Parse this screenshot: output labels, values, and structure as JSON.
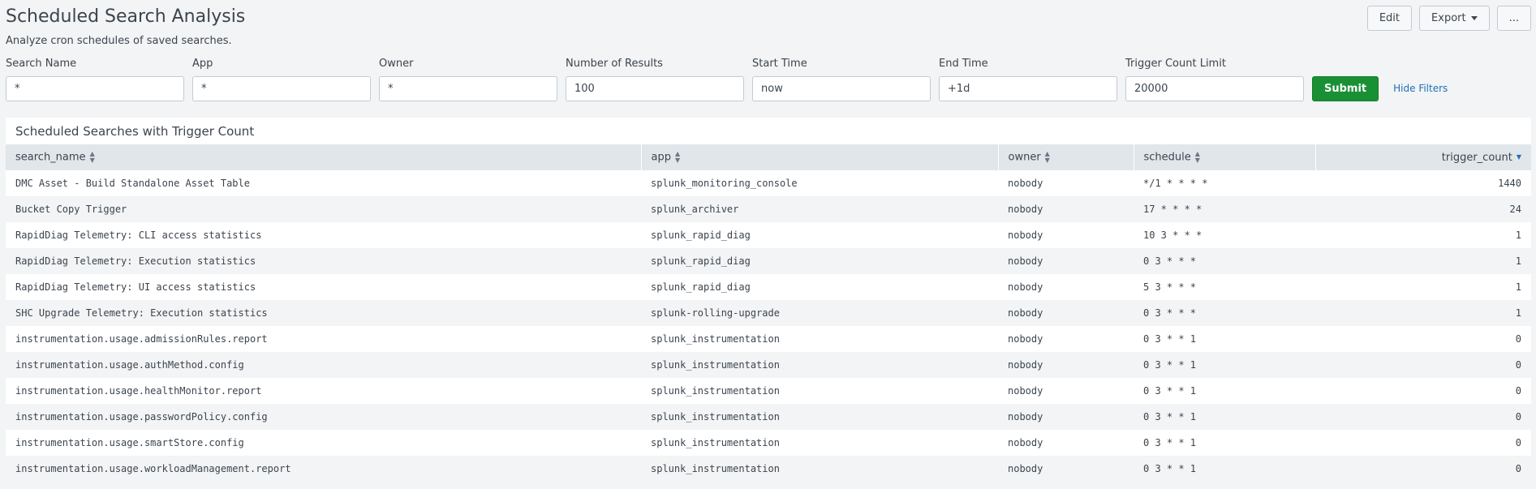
{
  "header": {
    "title": "Scheduled Search Analysis",
    "description": "Analyze cron schedules of saved searches.",
    "actions": {
      "edit": "Edit",
      "export": "Export",
      "more": "..."
    }
  },
  "filters": [
    {
      "label": "Search Name",
      "value": "*"
    },
    {
      "label": "App",
      "value": "*"
    },
    {
      "label": "Owner",
      "value": "*"
    },
    {
      "label": "Number of Results",
      "value": "100"
    },
    {
      "label": "Start Time",
      "value": "now"
    },
    {
      "label": "End Time",
      "value": "+1d"
    },
    {
      "label": "Trigger Count Limit",
      "value": "20000"
    }
  ],
  "submit_label": "Submit",
  "hide_filters_label": "Hide Filters",
  "panel": {
    "title": "Scheduled Searches with Trigger Count",
    "columns": [
      "search_name",
      "app",
      "owner",
      "schedule",
      "trigger_count"
    ],
    "sorted_column": "trigger_count",
    "rows": [
      [
        "DMC Asset - Build Standalone Asset Table",
        "splunk_monitoring_console",
        "nobody",
        "*/1 * * * *",
        "1440"
      ],
      [
        "Bucket Copy Trigger",
        "splunk_archiver",
        "nobody",
        "17 * * * *",
        "24"
      ],
      [
        "RapidDiag Telemetry: CLI access statistics",
        "splunk_rapid_diag",
        "nobody",
        "10 3 * * *",
        "1"
      ],
      [
        "RapidDiag Telemetry: Execution statistics",
        "splunk_rapid_diag",
        "nobody",
        "0 3 * * *",
        "1"
      ],
      [
        "RapidDiag Telemetry: UI access statistics",
        "splunk_rapid_diag",
        "nobody",
        "5 3 * * *",
        "1"
      ],
      [
        "SHC Upgrade Telemetry: Execution statistics",
        "splunk-rolling-upgrade",
        "nobody",
        "0 3 * * *",
        "1"
      ],
      [
        "instrumentation.usage.admissionRules.report",
        "splunk_instrumentation",
        "nobody",
        "0 3 * * 1",
        "0"
      ],
      [
        "instrumentation.usage.authMethod.config",
        "splunk_instrumentation",
        "nobody",
        "0 3 * * 1",
        "0"
      ],
      [
        "instrumentation.usage.healthMonitor.report",
        "splunk_instrumentation",
        "nobody",
        "0 3 * * 1",
        "0"
      ],
      [
        "instrumentation.usage.passwordPolicy.config",
        "splunk_instrumentation",
        "nobody",
        "0 3 * * 1",
        "0"
      ],
      [
        "instrumentation.usage.smartStore.config",
        "splunk_instrumentation",
        "nobody",
        "0 3 * * 1",
        "0"
      ],
      [
        "instrumentation.usage.workloadManagement.report",
        "splunk_instrumentation",
        "nobody",
        "0 3 * * 1",
        "0"
      ]
    ]
  },
  "colors": {
    "submit": "#1a9035",
    "link": "#1e6fb8",
    "table_header": "#e1e6eb",
    "page_bg": "#f2f4f5"
  }
}
